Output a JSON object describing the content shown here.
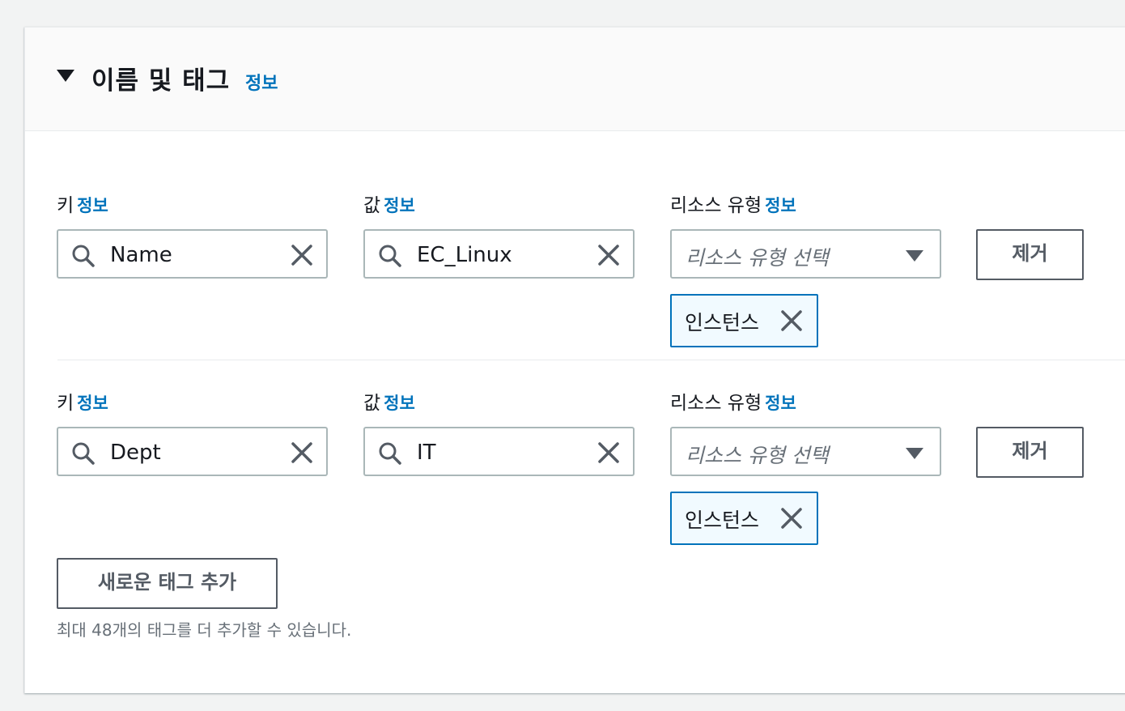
{
  "section": {
    "title": "이름 및 태그",
    "info_link": "정보"
  },
  "tags": [
    {
      "key_label": "키",
      "key_info": "정보",
      "key_value": "Name",
      "value_label": "값",
      "value_info": "정보",
      "value_value": "EC_Linux",
      "resource_label": "리소스 유형",
      "resource_info": "정보",
      "resource_placeholder": "리소스 유형 선택",
      "remove_label": "제거",
      "token_label": "인스턴스"
    },
    {
      "key_label": "키",
      "key_info": "정보",
      "key_value": "Dept",
      "value_label": "값",
      "value_info": "정보",
      "value_value": "IT",
      "resource_label": "리소스 유형",
      "resource_info": "정보",
      "resource_placeholder": "리소스 유형 선택",
      "remove_label": "제거",
      "token_label": "인스턴스"
    }
  ],
  "add_tag_button": "새로운 태그 추가",
  "hint": "최대 48개의 태그를 더 추가할 수 있습니다.",
  "icons": {
    "search": "search-icon",
    "clear": "close-icon",
    "caret": "caret-down-icon",
    "token_remove": "close-icon"
  },
  "colors": {
    "link": "#0073bb",
    "token_border": "#0073bb",
    "token_bg": "#f1faff",
    "input_border": "#aab7b8"
  }
}
